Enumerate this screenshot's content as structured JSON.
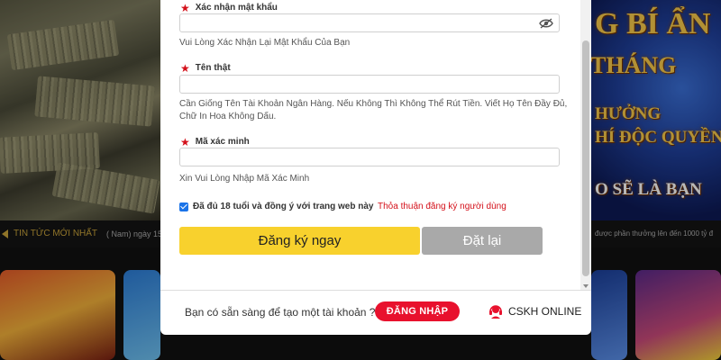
{
  "background": {
    "promo_lines": [
      "G BÍ ẨN",
      "THÁNG",
      "HƯỞNG",
      "HÍ ĐỘC QUYỀN",
      "O SẼ LÀ BẠN"
    ],
    "ticker_label": "TIN TỨC MỚI NHẤT",
    "ticker_text_left": "( Nam) ngày 15",
    "ticker_text_right": "được phần thưởng lên đến 1000 tỷ đ"
  },
  "form": {
    "confirm_password": {
      "label": "Xác nhận mật khẩu",
      "value": "",
      "hint": "Vui Lòng Xác Nhận Lại Mật Khẩu Của Bạn"
    },
    "real_name": {
      "label": "Tên thật",
      "value": "",
      "hint": "Cần Giống Tên Tài Khoản Ngân Hàng. Nếu Không Thì Không Thể Rút Tiền. Viết Họ Tên Đầy Đủ, Chữ In Hoa Không Dấu."
    },
    "verification_code": {
      "label": "Mã xác minh",
      "value": "",
      "hint": "Xin Vui Lòng Nhập Mã Xác Minh"
    },
    "agree": {
      "label": "Đã đủ 18 tuổi và đồng ý với trang web này",
      "checked": true,
      "terms_link": "Thỏa thuận đăng ký người dùng"
    },
    "register_button": "Đăng ký ngay",
    "reset_button": "Đặt lại"
  },
  "footer": {
    "question": "Bạn có sẵn sàng để tạo một tài khoản ?",
    "login_button": "ĐĂNG NHẬP",
    "support_label": "CSKH ONLINE"
  },
  "colors": {
    "accent_red": "#e8112d",
    "register_yellow": "#f8d12d",
    "reset_gray": "#a9a9a9",
    "checkbox_blue": "#1a73e8"
  },
  "icons": [
    "required-star-icon",
    "eye-slash-icon",
    "checkbox-checked-icon",
    "support-headset-icon",
    "scroll-down-arrow-icon"
  ]
}
